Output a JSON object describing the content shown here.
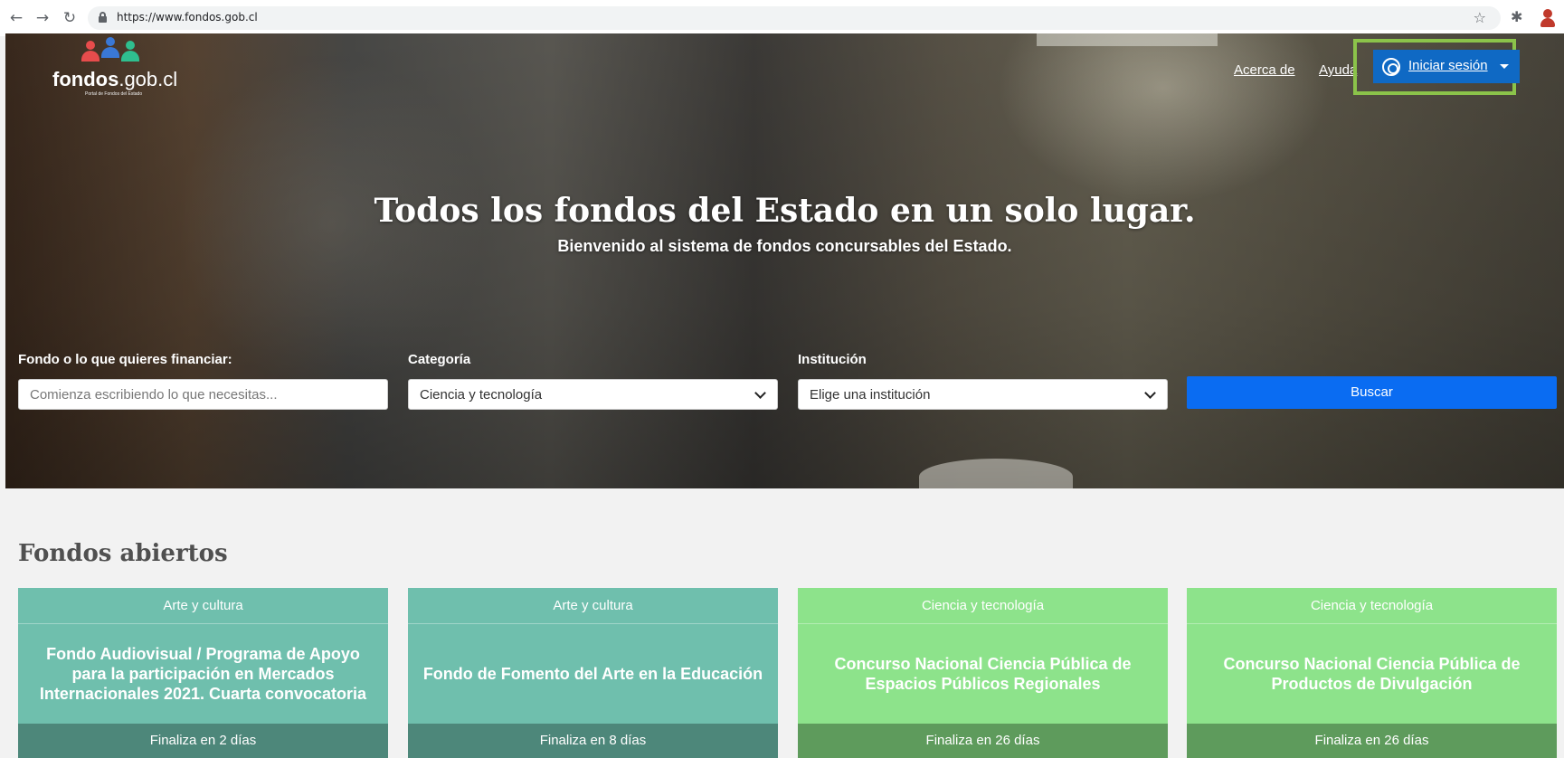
{
  "browser": {
    "url": "https://www.fondos.gob.cl",
    "icons": {
      "back": "arrow-left-icon",
      "forward": "arrow-right-icon",
      "reload": "reload-icon",
      "lock": "lock-icon",
      "bookmark": "star-icon",
      "extensions": "puzzle-icon",
      "profile": "profile-icon"
    }
  },
  "header": {
    "logo": {
      "brand_bold": "fondos",
      "brand_rest": ".gob.cl",
      "tagline": "Portal de Fondos del Estado"
    },
    "nav": {
      "about": "Acerca de",
      "help": "Ayuda"
    },
    "login": {
      "label": "Iniciar sesión",
      "highlight_color": "#8bc34a",
      "button_color": "#0f69c4"
    }
  },
  "hero": {
    "title": "Todos los fondos del Estado en un solo lugar.",
    "subtitle": "Bienvenido al sistema de fondos concursables del Estado."
  },
  "search": {
    "fund_label": "Fondo o lo que quieres financiar:",
    "fund_placeholder": "Comienza escribiendo lo que necesitas...",
    "category_label": "Categoría",
    "category_value": "Ciencia y tecnología",
    "institution_label": "Institución",
    "institution_value": "Elige una institución",
    "button": "Buscar",
    "button_color": "#0a6cf2"
  },
  "open_funds": {
    "title": "Fondos abiertos",
    "cards": [
      {
        "category": "Arte y cultura",
        "title": "Fondo Audiovisual / Programa de Apoyo para la participación en Mercados Internacionales 2021. Cuarta convocatoria",
        "deadline": "Finaliza en 2 días"
      },
      {
        "category": "Arte y cultura",
        "title": "Fondo de Fomento del Arte en la Educación",
        "deadline": "Finaliza en 8 días"
      },
      {
        "category": "Ciencia y tecnología",
        "title": "Concurso Nacional Ciencia Pública de Espacios Públicos Regionales",
        "deadline": "Finaliza en 26 días"
      },
      {
        "category": "Ciencia y tecnología",
        "title": "Concurso Nacional Ciencia Pública de Productos de Divulgación",
        "deadline": "Finaliza en 26 días"
      }
    ],
    "colors": {
      "arts": "#6fbfad",
      "arts_footer": "#4d877a",
      "science": "#8de38b",
      "science_footer": "#5e9b5c"
    }
  }
}
